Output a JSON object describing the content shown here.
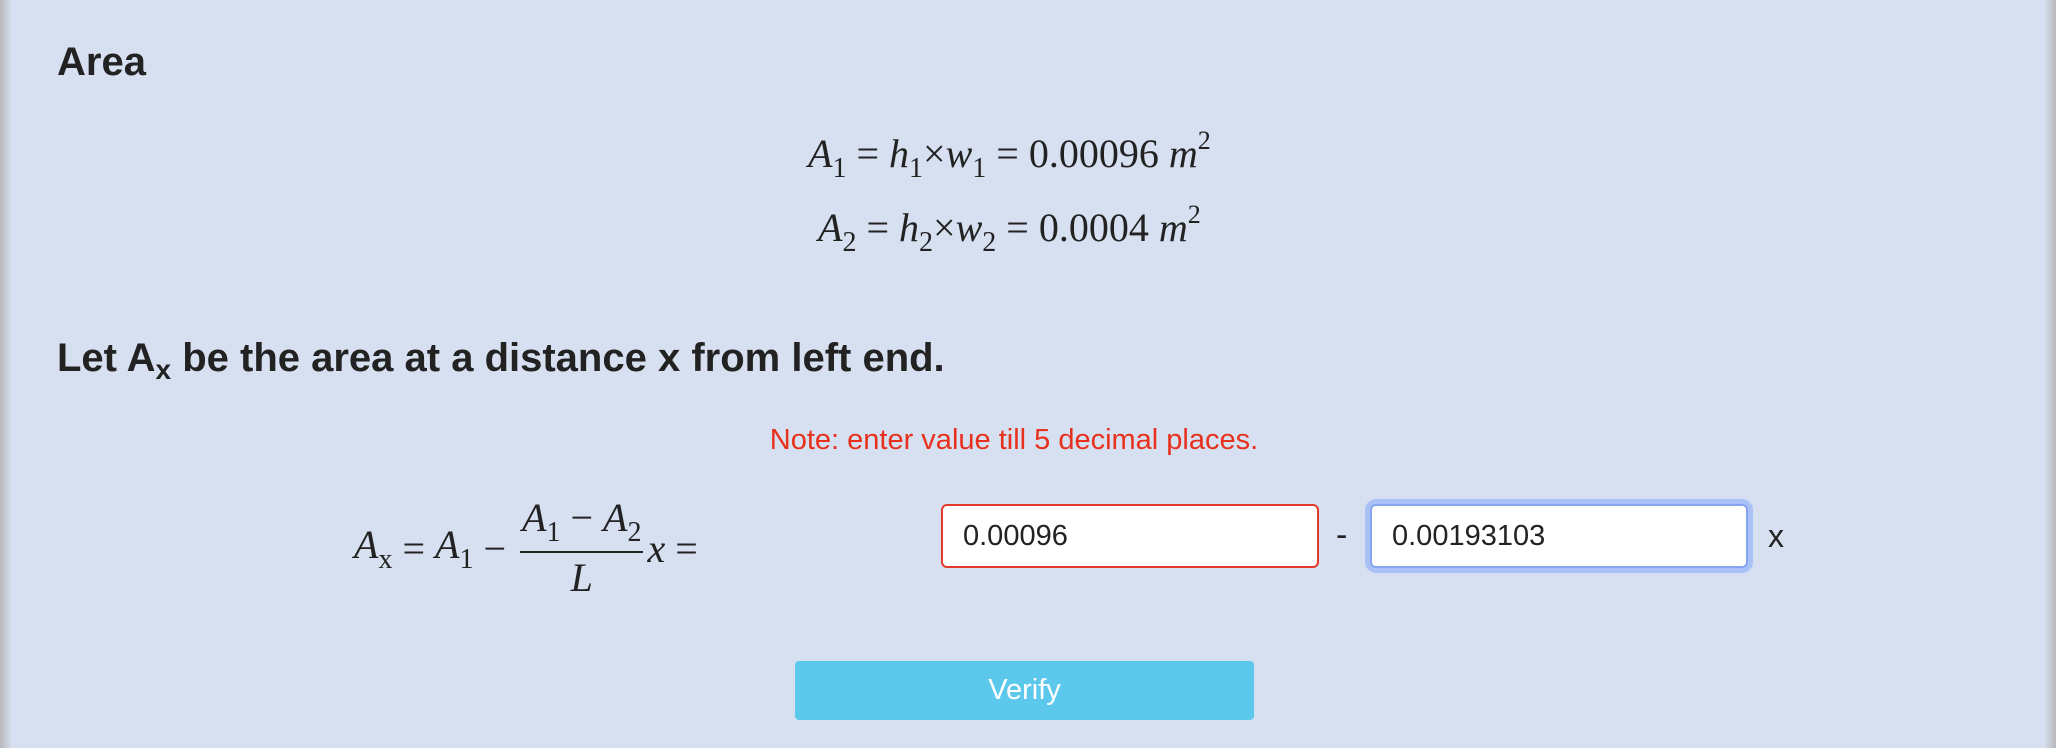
{
  "area_section": {
    "heading": "Area",
    "eq1": {
      "lhs": "A",
      "lhs_sub": "1",
      "h": "h",
      "h_sub": "1",
      "w": "w",
      "w_sub": "1",
      "value": "0.00096",
      "unit": "m",
      "unit_sup": "2"
    },
    "eq2": {
      "lhs": "A",
      "lhs_sub": "2",
      "h": "h",
      "h_sub": "2",
      "w": "w",
      "w_sub": "2",
      "value": "0.0004",
      "unit": "m",
      "unit_sup": "2"
    }
  },
  "let_section": {
    "heading_pre": "Let A",
    "heading_sub": "x",
    "heading_post": " be the area at a distance x from left end."
  },
  "note": "Note: enter value till 5 decimal places.",
  "formula": {
    "lhs": "A",
    "lhs_sub": "x",
    "a1": "A",
    "a1_sub": "1",
    "num_a1": "A",
    "num_a1_sub": "1",
    "num_a2": "A",
    "num_a2_sub": "2",
    "den": "L",
    "var": "x"
  },
  "inputs": {
    "first_value": "0.00096",
    "separator": "-",
    "second_value": "0.00193103",
    "suffix": "x"
  },
  "verify_label": "Verify",
  "colors": {
    "background": "#d6e0f0",
    "note": "#e8311c",
    "button": "#5bc8ec",
    "error_border": "#e23a2a",
    "focus_ring": "#a9c1f6"
  }
}
